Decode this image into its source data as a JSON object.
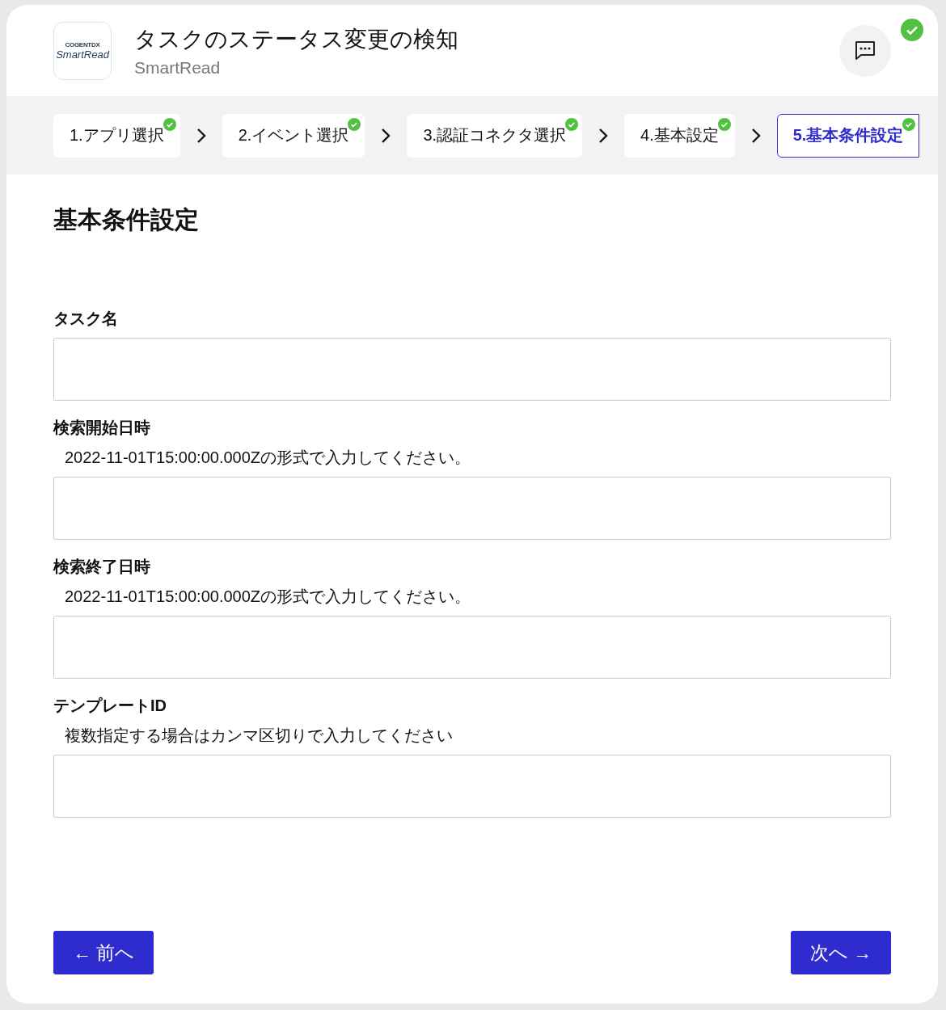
{
  "header": {
    "logo": {
      "brand": "COGENTDX",
      "name": "SmartRead"
    },
    "title": "タスクのステータス変更の検知",
    "subtitle": "SmartRead",
    "status_ok": true
  },
  "steps": [
    {
      "label": "1.アプリ選択",
      "completed": true,
      "selected": false
    },
    {
      "label": "2.イベント選択",
      "completed": true,
      "selected": false
    },
    {
      "label": "3.認証コネクタ選択",
      "completed": true,
      "selected": false
    },
    {
      "label": "4.基本設定",
      "completed": true,
      "selected": false
    },
    {
      "label": "5.基本条件設定",
      "completed": true,
      "selected": true
    }
  ],
  "heading": "基本条件設定",
  "fields": [
    {
      "label": "タスク名"
    },
    {
      "label": "検索開始日時",
      "hint": "2022-11-01T15:00:00.000Zの形式で入力してください。"
    },
    {
      "label": "検索終了日時",
      "hint": "2022-11-01T15:00:00.000Zの形式で入力してください。"
    },
    {
      "label": "テンプレートID",
      "hint": "複数指定する場合はカンマ区切りで入力してください"
    }
  ],
  "buttons": {
    "back": "← 前へ",
    "next": "次へ →"
  }
}
